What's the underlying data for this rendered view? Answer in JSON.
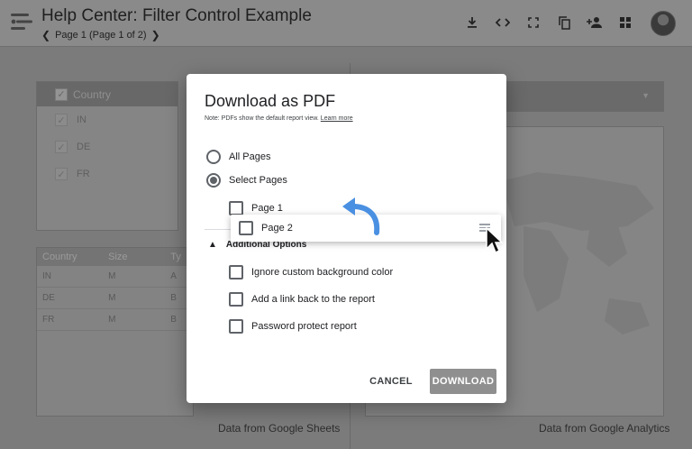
{
  "header": {
    "title": "Help Center: Filter Control Example",
    "pager_label": "Page 1 (Page 1 of 2)",
    "icons": [
      "download-icon",
      "embed-code-icon",
      "fullscreen-icon",
      "copy-icon",
      "add-person-icon",
      "apps-grid-icon",
      "user-avatar"
    ]
  },
  "report": {
    "filter": {
      "header": "Country",
      "items": [
        "IN",
        "DE",
        "FR"
      ]
    },
    "table": {
      "columns": [
        "Country",
        "Size",
        "Ty"
      ],
      "rows": [
        [
          "IN",
          "M",
          "A"
        ],
        [
          "DE",
          "M",
          "B"
        ],
        [
          "FR",
          "M",
          "B"
        ]
      ]
    },
    "left_footnote": "Data from Google Sheets",
    "right_footnote": "Data from Google Analytics"
  },
  "modal": {
    "title": "Download as PDF",
    "note": "Note: PDFs show the default report view.",
    "note_link": "Learn more",
    "radio_all": "All Pages",
    "radio_select": "Select Pages",
    "selected_radio": "Select Pages",
    "page1_label": "Page 1",
    "page2_label": "Page 2",
    "section_title": "Additional Options",
    "opt_bg": "Ignore custom background color",
    "opt_link": "Add a link back to the report",
    "opt_pw": "Password protect report",
    "cancel": "CANCEL",
    "download": "DOWNLOAD"
  },
  "colors": {
    "accent_arrow": "#4a90e2",
    "download_button": "#8f8f8f",
    "overlay": "#7a7a7a"
  }
}
